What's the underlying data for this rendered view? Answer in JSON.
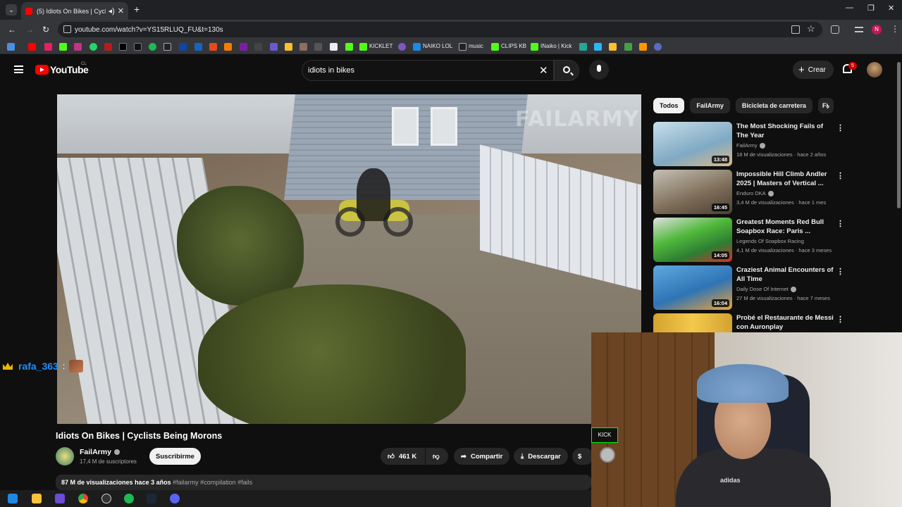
{
  "browser": {
    "tab_title": "(5) Idiots On Bikes | Cyclist",
    "url": "youtube.com/watch?v=YS15RLUQ_FU&t=130s",
    "bookmarks": [
      "KICKLET",
      "NAIKO LOL",
      "music",
      "CLIPS KB",
      "INaiko | Kick"
    ],
    "profile_letter": "N"
  },
  "youtube": {
    "logo": "YouTube",
    "country": "CL",
    "search_query": "idiots in bikes",
    "create_label": "Crear",
    "notif_count": "5"
  },
  "video": {
    "title": "Idiots On Bikes | Cyclists Being Morons",
    "watermark": "FAILARMY",
    "channel": "FailArmy",
    "subscribers": "17,4 M de suscriptores",
    "subscribe_label": "Suscribirme",
    "likes": "461 K",
    "share_label": "Compartir",
    "download_label": "Descargar",
    "views": "87 M de visualizaciones",
    "age": "hace 3 años",
    "tags": "#failarmy #compilation #fails"
  },
  "chat": {
    "username": "rafa_363",
    "separator": ":"
  },
  "chips": [
    "Todos",
    "FailArmy",
    "Bicicleta de carretera",
    "Fi"
  ],
  "recommendations": [
    {
      "title": "The Most Shocking Fails of The Year",
      "channel": "FailArmy",
      "verified": true,
      "meta": "18 M de visualizaciones · hace 2 años",
      "duration": "13:48",
      "thumb_color": "#9fc4d8"
    },
    {
      "title": "Impossible Hill Climb Andler 2025 | Masters of Vertical ...",
      "channel": "Enduro DKA",
      "verified": true,
      "meta": "3,4 M de visualizaciones · hace 1 mes",
      "duration": "16:45",
      "thumb_color": "#7a6a55"
    },
    {
      "title": "Greatest Moments Red Bull Soapbox Race: Paris ...",
      "channel": "Legends Of Soapbox Racing",
      "verified": false,
      "meta": "4,1 M de visualizaciones · hace 3 meses",
      "duration": "14:05",
      "thumb_color": "#4fb83a"
    },
    {
      "title": "Craziest Animal Encounters of All Time",
      "channel": "Daily Dose Of Internet",
      "verified": true,
      "meta": "27 M de visualizaciones · hace 7 meses",
      "duration": "16:04",
      "thumb_color": "#3f8fd0"
    },
    {
      "title": "Probé el Restaurante de Messi con Auronplay",
      "channel": "",
      "verified": false,
      "meta": "",
      "duration": "",
      "thumb_color": "#d4a230"
    }
  ],
  "webcam": {
    "shirt_text": "adidas",
    "badge_text": "KICK"
  }
}
